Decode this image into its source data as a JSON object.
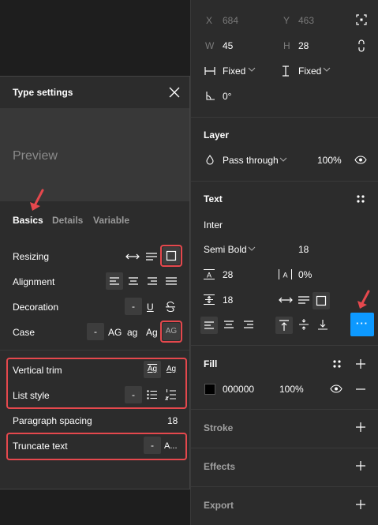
{
  "position": {
    "x_label": "X",
    "x_value": "684",
    "y_label": "Y",
    "y_value": "463"
  },
  "size": {
    "w_label": "W",
    "w_value": "45",
    "h_label": "H",
    "h_value": "28"
  },
  "resizing_mode": {
    "horizontal": "Fixed",
    "vertical": "Fixed"
  },
  "rotation": {
    "value": "0°"
  },
  "layer": {
    "title": "Layer",
    "blend_mode": "Pass through",
    "opacity": "100%"
  },
  "text": {
    "title": "Text",
    "font_family": "Inter",
    "font_weight": "Semi Bold",
    "font_size": "18",
    "line_height": "28",
    "letter_spacing": "0%",
    "paragraph_spacing": "18",
    "more_label": "···"
  },
  "fill": {
    "title": "Fill",
    "hex": "000000",
    "opacity": "100%",
    "swatch_color": "#000000"
  },
  "stroke": {
    "title": "Stroke"
  },
  "effects": {
    "title": "Effects"
  },
  "export": {
    "title": "Export"
  },
  "type_settings": {
    "title": "Type settings",
    "preview": "Preview",
    "tabs": [
      {
        "label": "Basics"
      },
      {
        "label": "Details"
      },
      {
        "label": "Variable"
      }
    ],
    "rows": {
      "resizing": "Resizing",
      "alignment": "Alignment",
      "decoration": "Decoration",
      "case": "Case",
      "vertical_trim": "Vertical trim",
      "list_style": "List style",
      "paragraph_spacing": "Paragraph spacing",
      "paragraph_spacing_value": "18",
      "truncate_text": "Truncate text"
    },
    "case_options": {
      "none": "-",
      "upper": "AG",
      "lower": "ag",
      "title": "Ag",
      "small_caps": "AG"
    },
    "trim_options": {
      "standard": "Ag",
      "cap": "Ag"
    },
    "decoration_none": "-",
    "decoration_underline": "U",
    "list_none": "-",
    "truncate_none": "-",
    "truncate_ellipsis": "A..."
  },
  "colors": {
    "accent": "#0d99ff",
    "annotation": "#e5484d",
    "panel": "#2c2c2c",
    "background": "#1e1e1e"
  }
}
